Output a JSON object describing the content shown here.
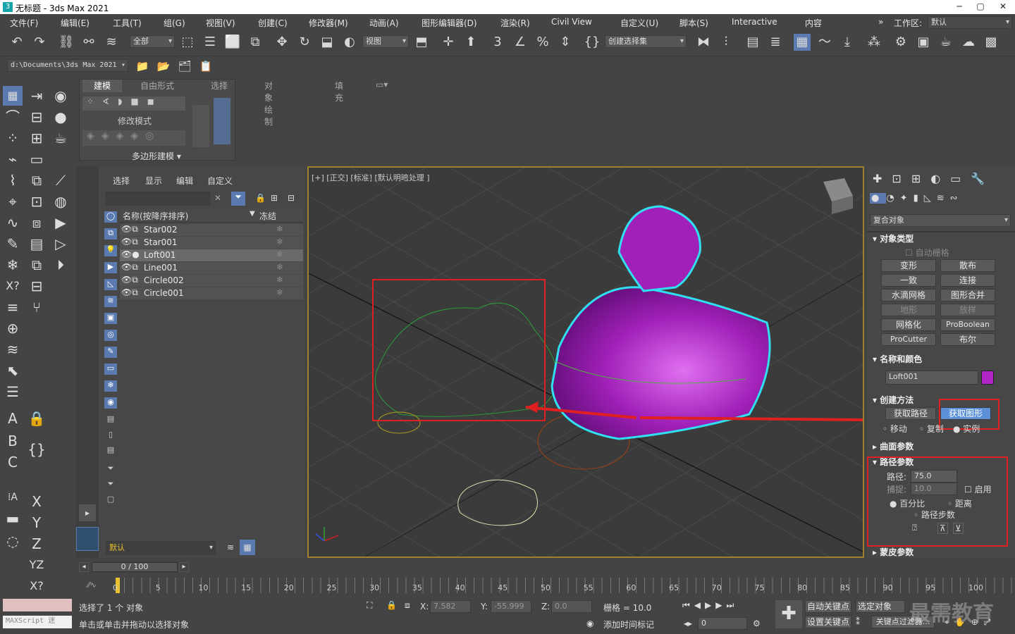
{
  "titlebar": {
    "title": "无标题 - 3ds Max 2021"
  },
  "menu": [
    "文件(F)",
    "编辑(E)",
    "工具(T)",
    "组(G)",
    "视图(V)",
    "创建(C)",
    "修改器(M)",
    "动画(A)",
    "图形编辑器(D)",
    "渲染(R)",
    "Civil View",
    "自定义(U)",
    "脚本(S)",
    "Interactive",
    "内容"
  ],
  "workspace": {
    "label": "工作区:",
    "value": "默认"
  },
  "toolbar": {
    "filter": "全部",
    "refcoord": "视图",
    "selset": "创建选择集",
    "path": "d:\\Documents\\3ds Max 2021"
  },
  "ribbon": {
    "tabs": [
      "建模",
      "自由形式",
      "选择",
      "对象绘制",
      "填充"
    ],
    "mode": "修改模式",
    "poly": "多边形建模"
  },
  "scene": {
    "tabs": [
      "选择",
      "显示",
      "编辑",
      "自定义"
    ],
    "col_name": "名称(按降序排序)",
    "col_freeze": "冻结",
    "items": [
      "Star002",
      "Star001",
      "Loft001",
      "Line001",
      "Circle002",
      "Circle001"
    ],
    "layer": "默认"
  },
  "viewport": {
    "label": "[+] [正交] [标准] [默认明暗处理 ]"
  },
  "cmd": {
    "category": "复合对象",
    "obj_type": "对象类型",
    "autogrid": "自动栅格",
    "buttons": [
      [
        "变形",
        "散布"
      ],
      [
        "一致",
        "连接"
      ],
      [
        "水滴网格",
        "图形合并"
      ],
      [
        "地形",
        "放样"
      ],
      [
        "网格化",
        "ProBoolean"
      ],
      [
        "ProCutter",
        "布尔"
      ]
    ],
    "name_color": "名称和颜色",
    "obj_name": "Loft001",
    "obj_color": "#b024c8",
    "creation": "创建方法",
    "get_path": "获取路径",
    "get_shape": "获取图形",
    "move": "移动",
    "copy": "复制",
    "instance": "实例",
    "surface": "曲面参数",
    "path_params": "路径参数",
    "path_label": "路径:",
    "path_val": "75.0",
    "snap_label": "捕捉:",
    "snap_val": "10.0",
    "enable": "启用",
    "percent": "百分比",
    "distance": "距离",
    "steps": "路径步数",
    "skin": "蒙皮参数"
  },
  "timeline": {
    "frame": "0 / 100",
    "ticks": [
      "0",
      "5",
      "10",
      "15",
      "20",
      "25",
      "30",
      "35",
      "40",
      "45",
      "50",
      "55",
      "60",
      "65",
      "70",
      "75",
      "80",
      "85",
      "90",
      "95",
      "100"
    ]
  },
  "status": {
    "selected": "选择了 1 个 对象",
    "hint": "单击或单击并拖动以选择对象",
    "x_label": "X:",
    "x": "7.582",
    "y_label": "Y:",
    "y": "-55.999",
    "z_label": "Z:",
    "z": "0.0",
    "grid": "栅格 = 10.0",
    "add_tag": "添加时间标记",
    "autokey": "自动关键点",
    "selobj": "选定对象",
    "setkey": "设置关键点",
    "keyfilter": "关键点过滤器...",
    "frame_val": "0",
    "maxscript": "MAXScript 迷",
    "watermark": "最需教育"
  }
}
